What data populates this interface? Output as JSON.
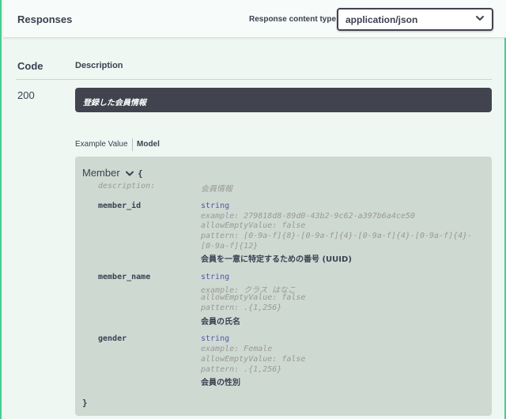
{
  "responses": {
    "title": "Responses",
    "content_type_label": "Response content type",
    "content_type_value": "application/json"
  },
  "table": {
    "code_header": "Code",
    "description_header": "Description"
  },
  "response": {
    "code": "200",
    "description": "登録した会員情報"
  },
  "tabs": {
    "example_value": "Example Value",
    "model": "Model"
  },
  "model": {
    "name": "Member",
    "open_brace": "{",
    "close_brace": "}",
    "description_key": "description:",
    "description_value": "会員情報",
    "properties": [
      {
        "name": "member_id",
        "type": "string",
        "meta": [
          "example: 279818d8-89d0-43b2-9c62-a397b6a4ce50",
          "allowEmptyValue: false",
          "pattern: [0-9a-f]{8}-[0-9a-f]{4}-[0-9a-f]{4}-[0-9a-f]{4}-",
          "[0-9a-f]{12}"
        ],
        "description": "会員を一意に特定するための番号 (UUID)"
      },
      {
        "name": "member_name",
        "type": "string",
        "meta": [
          "example: クラス はなこ",
          "allowEmptyValue: false",
          "pattern: .{1,256}"
        ],
        "description": "会員の氏名"
      },
      {
        "name": "gender",
        "type": "string",
        "meta": [
          "example: Female",
          "allowEmptyValue: false",
          "pattern: .{1,256}"
        ],
        "description": "会員の性別"
      }
    ]
  },
  "icons": {
    "select_chevron": "chevron-down-icon",
    "model_toggle": "chevron-down-icon"
  },
  "colors": {
    "accent_green": "#49cc90",
    "dark_box": "#41444e",
    "model_bg": "#ced9d2",
    "type_color": "#5555aa"
  }
}
